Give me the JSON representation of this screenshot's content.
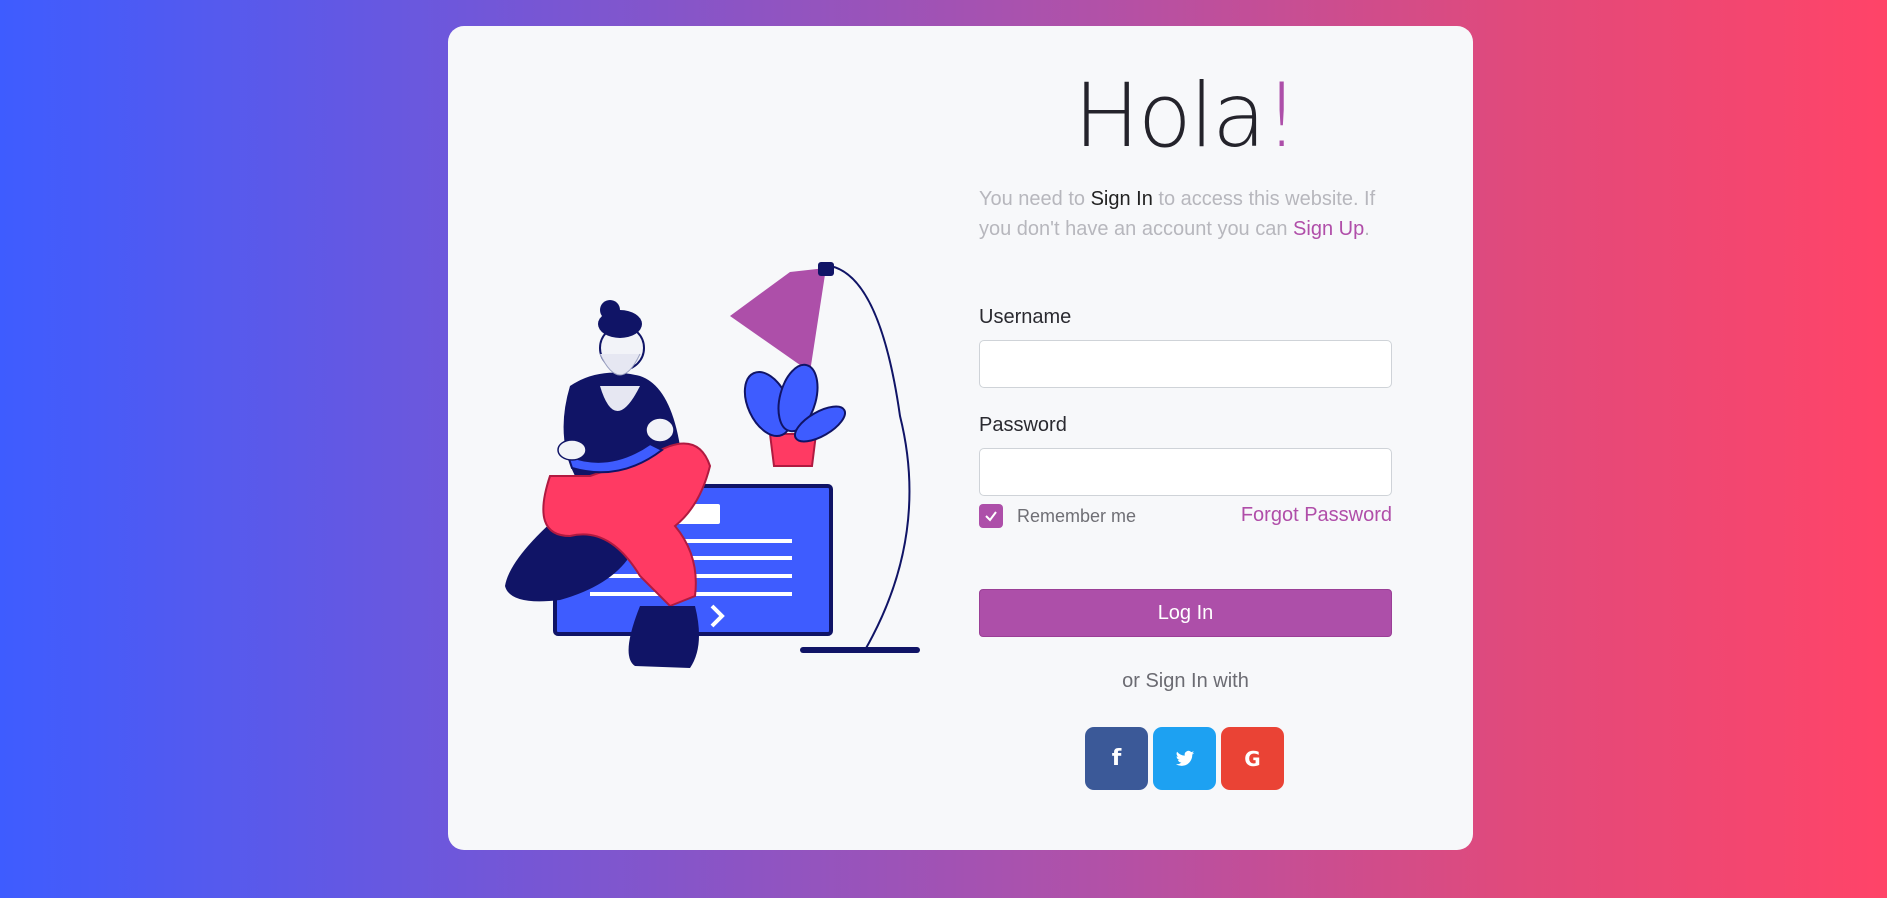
{
  "header": {
    "title_main": "Hola",
    "title_accent": "!"
  },
  "intro": {
    "part1": "You need to ",
    "sign_in": "Sign In",
    "part2": " to access this website. If you don't have an account you can ",
    "sign_up": "Sign Up",
    "part3": "."
  },
  "form": {
    "username_label": "Username",
    "username_value": "",
    "password_label": "Password",
    "password_value": "",
    "remember_label": "Remember me",
    "remember_checked": true,
    "forgot_label": "Forgot Password",
    "login_label": "Log In",
    "or_text": "or Sign In with"
  },
  "socials": [
    {
      "name": "facebook-icon",
      "glyph": "f",
      "color": "#3b5998"
    },
    {
      "name": "twitter-icon",
      "glyph": "bird",
      "color": "#1da1f2"
    },
    {
      "name": "google-icon",
      "glyph": "G",
      "color": "#ea4335"
    }
  ],
  "colors": {
    "accent": "#ad4fa9",
    "brand_blue": "#3e5cff",
    "brand_pink": "#ff4468"
  }
}
